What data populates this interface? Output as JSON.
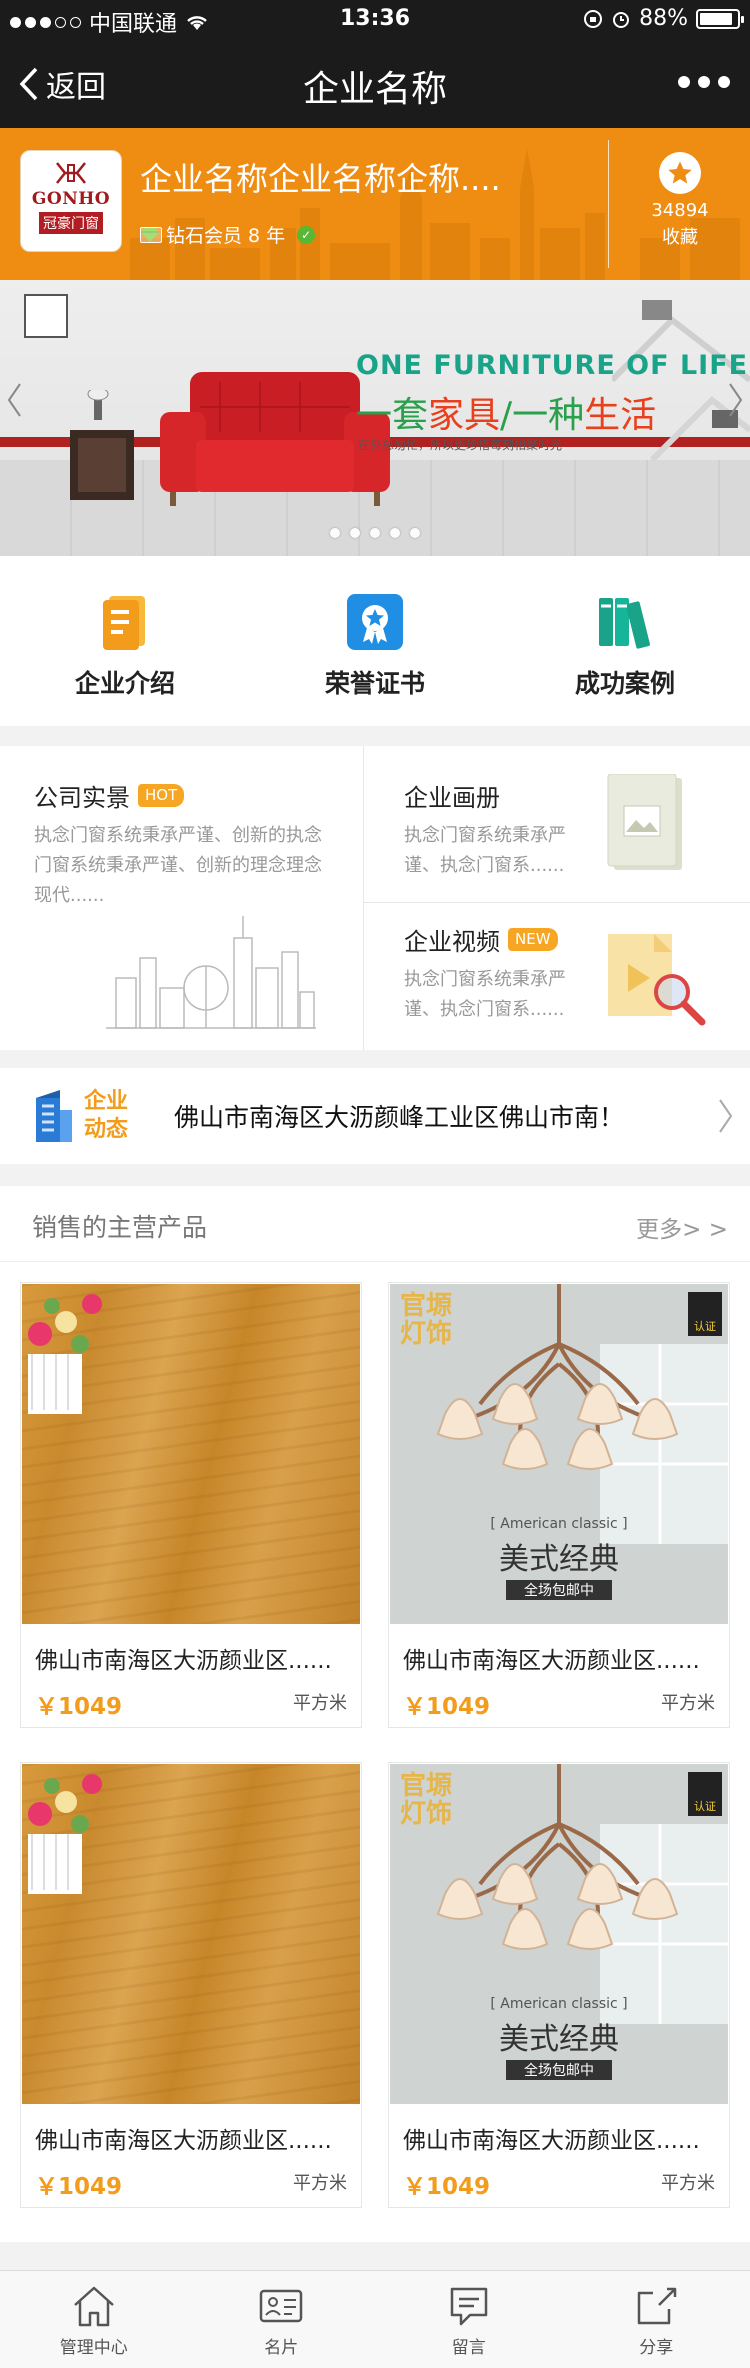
{
  "status_bar": {
    "carrier": "中国联通",
    "time": "13:36",
    "battery": "88%",
    "battery_level": 0.88
  },
  "nav": {
    "back_label": "返回",
    "title": "企业名称"
  },
  "company": {
    "logo": {
      "en": "GONHO",
      "cn": "冠豪门窗"
    },
    "name": "企业名称企业名称企称....",
    "member": "钻石会员 8 年",
    "favorites_count": "34894",
    "favorites_label": "收藏"
  },
  "banner": {
    "headline_en": "ONE FURNITURE  OF LIFE",
    "headline_cn_1": "一套",
    "headline_cn_2": "家具",
    "headline_cn_3": "/一种",
    "headline_cn_4": "生活",
    "subline": "在外总匆忙，所以更珍惜每刻相聚时光",
    "slide_count": 5,
    "active_slide": 1
  },
  "quick_links": [
    {
      "label": "企业介绍",
      "icon": "document-icon"
    },
    {
      "label": "荣誉证书",
      "icon": "certificate-icon"
    },
    {
      "label": "成功案例",
      "icon": "books-icon"
    }
  ],
  "info": {
    "scenery": {
      "title": "公司实景",
      "tag": "HOT",
      "desc": "执念门窗系统秉承严谨、创新的执念门窗系统秉承严谨、创新的理念理念现代......"
    },
    "album": {
      "title": "企业画册",
      "desc": "执念门窗系统秉承严谨、执念门窗系......"
    },
    "video": {
      "title": "企业视频",
      "tag": "NEW",
      "desc": "执念门窗系统秉承严谨、执念门窗系......"
    }
  },
  "news": {
    "label_1": "企业",
    "label_2": "动态",
    "text": "佛山市南海区大沥颜峰工业区佛山市南！"
  },
  "products": {
    "title": "销售的主营产品",
    "more": "更多> >",
    "items": [
      {
        "name": "佛山市南海区大沥颜业区......",
        "price": "￥1049",
        "unit": "平方米",
        "image": "wood-floor"
      },
      {
        "name": "佛山市南海区大沥颜业区......",
        "price": "￥1049",
        "unit": "平方米",
        "image": "chandelier"
      },
      {
        "name": "佛山市南海区大沥颜业区......",
        "price": "￥1049",
        "unit": "平方米",
        "image": "wood-floor"
      },
      {
        "name": "佛山市南海区大沥颜业区......",
        "price": "￥1049",
        "unit": "平方米",
        "image": "chandelier"
      }
    ],
    "lamp_badge": "官塬灯饰",
    "lamp_caption_en": "[ American classic ]",
    "lamp_caption_cn": "美式经典",
    "lamp_ribbon": "全场包邮中",
    "lamp_cert": "认证"
  },
  "tabbar": [
    {
      "label": "管理中心",
      "icon": "home-icon"
    },
    {
      "label": "名片",
      "icon": "card-icon"
    },
    {
      "label": "留言",
      "icon": "message-icon"
    },
    {
      "label": "分享",
      "icon": "share-icon"
    }
  ],
  "colors": {
    "accent": "#f39b1a",
    "header_orange": "#ef8c12",
    "bar_dark": "#1b1b1b",
    "sofa_red": "#d7262a"
  }
}
